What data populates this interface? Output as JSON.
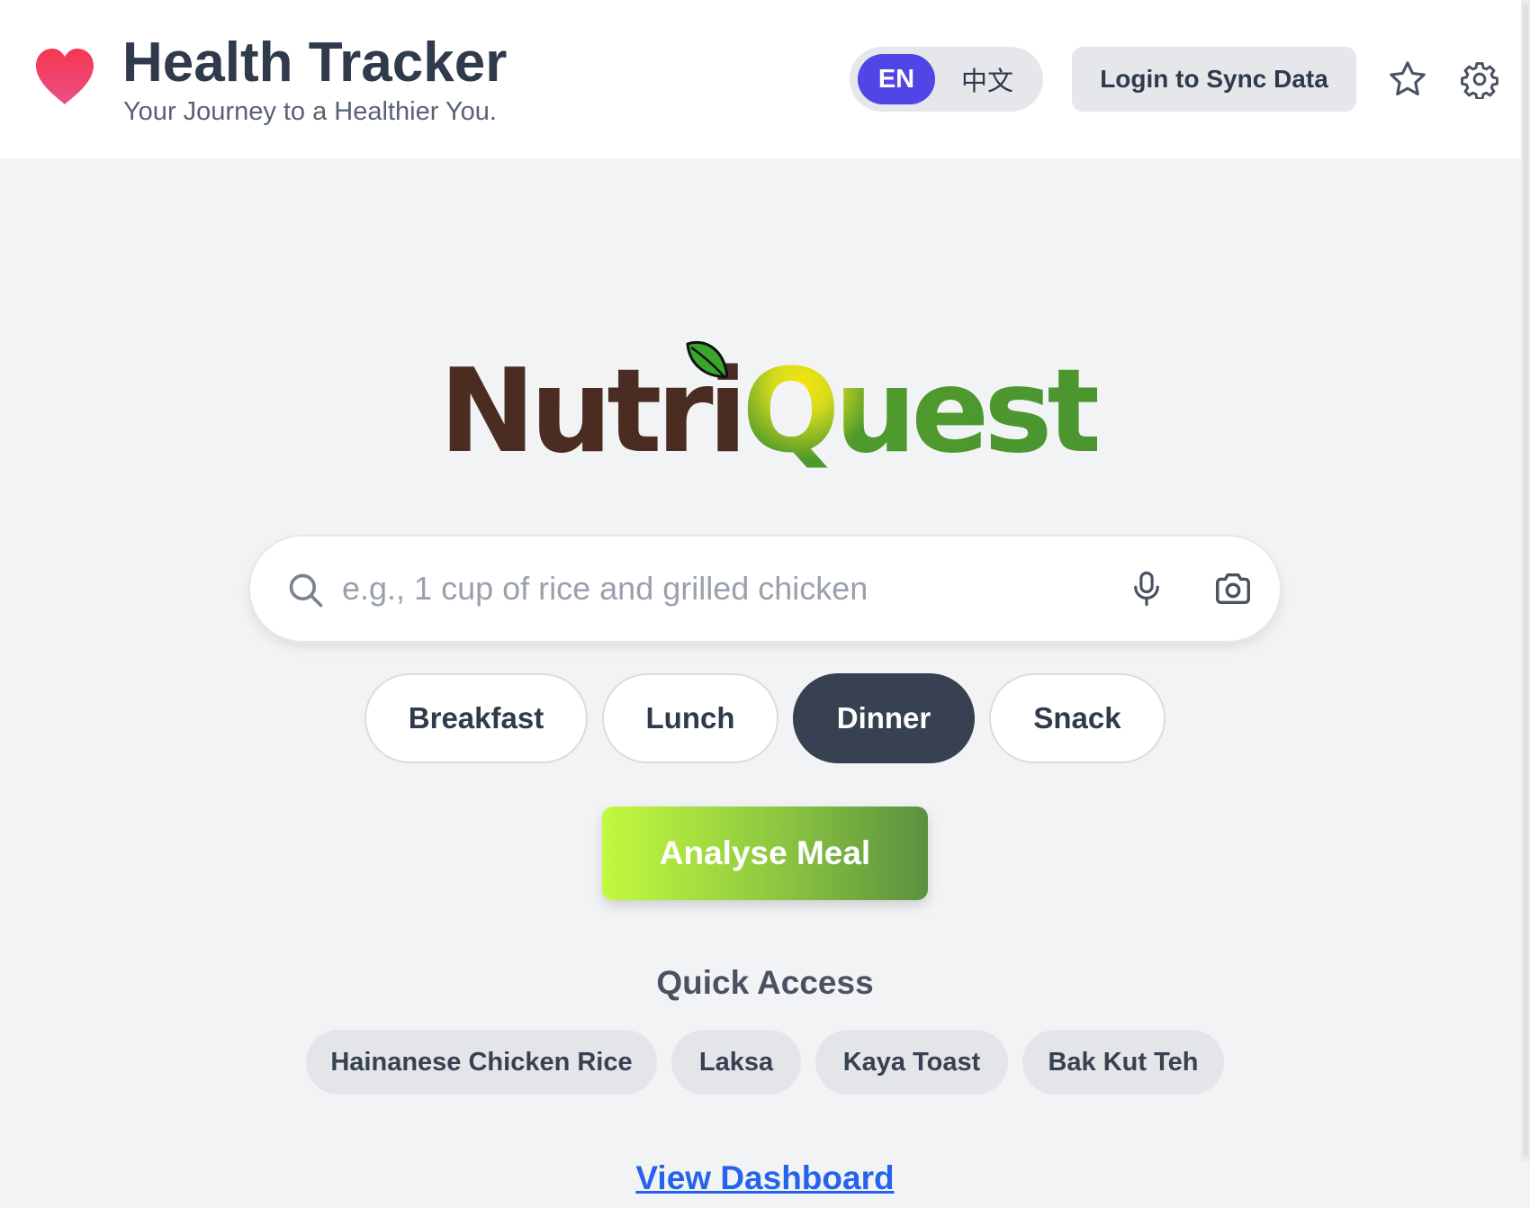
{
  "header": {
    "title": "Health Tracker",
    "subtitle": "Your Journey to a Healthier You.",
    "brand_icon": "heart-icon",
    "language": {
      "options": [
        "EN",
        "中文"
      ],
      "selected": "EN"
    },
    "login_label": "Login to Sync Data",
    "icons": [
      "star-icon",
      "gear-icon"
    ]
  },
  "logo": {
    "part1": "Nutri",
    "part2": "Quest",
    "leaf_icon": "leaf-icon"
  },
  "search": {
    "placeholder": "e.g., 1 cup of rice and grilled chicken",
    "value": "",
    "icons": [
      "search-icon",
      "microphone-icon",
      "camera-icon"
    ]
  },
  "meal_types": {
    "options": [
      "Breakfast",
      "Lunch",
      "Dinner",
      "Snack"
    ],
    "selected": "Dinner"
  },
  "analyse_label": "Analyse Meal",
  "quick_access": {
    "title": "Quick Access",
    "items": [
      "Hainanese Chicken Rice",
      "Laksa",
      "Kaya Toast",
      "Bak Kut Teh"
    ]
  },
  "dashboard_link": "View Dashboard",
  "colors": {
    "accent": "#4f46e5",
    "selected_pill": "#374151",
    "logo_brown": "#4a2c22",
    "logo_green": "#4b9530",
    "heart": "#f0436a",
    "link": "#2563eb"
  }
}
